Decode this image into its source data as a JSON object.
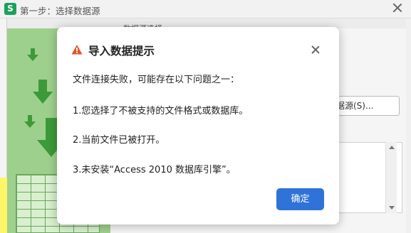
{
  "app": {
    "icon_letter": "S",
    "title": "第一步：选择数据源",
    "accent_color": "#1aa15a"
  },
  "background_panel": {
    "section_label": "数据源选择",
    "source_button_label": "据源(S)..."
  },
  "modal": {
    "title": "导入数据提示",
    "warning_icon": "warning-triangle-icon",
    "warning_color": "#e2542a",
    "messages": [
      "文件连接失败，可能存在以下问题之一：",
      "1.您选择了不被支持的文件格式或数据库。",
      "2.当前文件已被打开。",
      "3.未安装“Access 2010 数据库引擎”。"
    ],
    "ok_label": "确定",
    "ok_color": "#2f73d8"
  }
}
